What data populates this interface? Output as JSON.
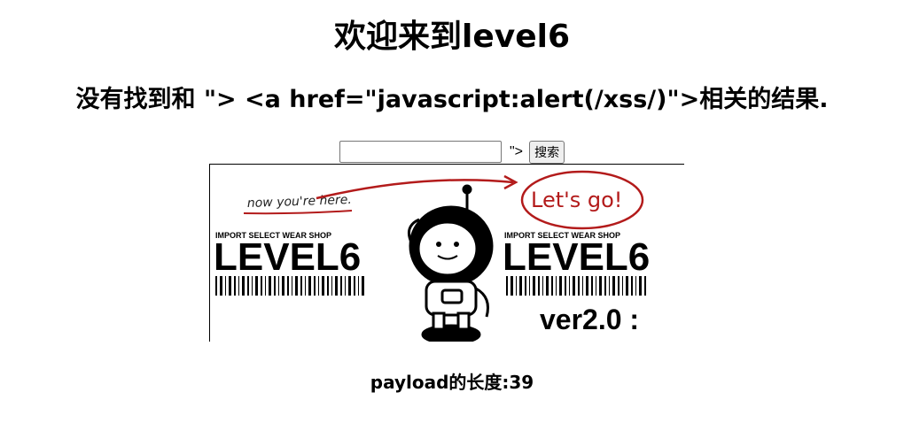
{
  "page": {
    "title": "欢迎来到level6",
    "result_message": "没有找到和 \"> <a href=\"javascript:alert(/xss/)\">相关的结果.",
    "search": {
      "value": "",
      "trailing_text": "\">",
      "button_label": "搜索"
    },
    "banner": {
      "left_note": "now you're here.",
      "right_note": "Let's go!",
      "shop_label_left": "IMPORT SELECT WEAR SHOP",
      "shop_label_right": "IMPORT SELECT WEAR SHOP",
      "level_left": "LEVEL6",
      "level_right": "LEVEL6",
      "version": "ver2.0 :"
    },
    "payload_length": "payload的长度:39"
  },
  "colors": {
    "text": "#000000",
    "accent_red": "#b31b1b",
    "background": "#ffffff"
  }
}
